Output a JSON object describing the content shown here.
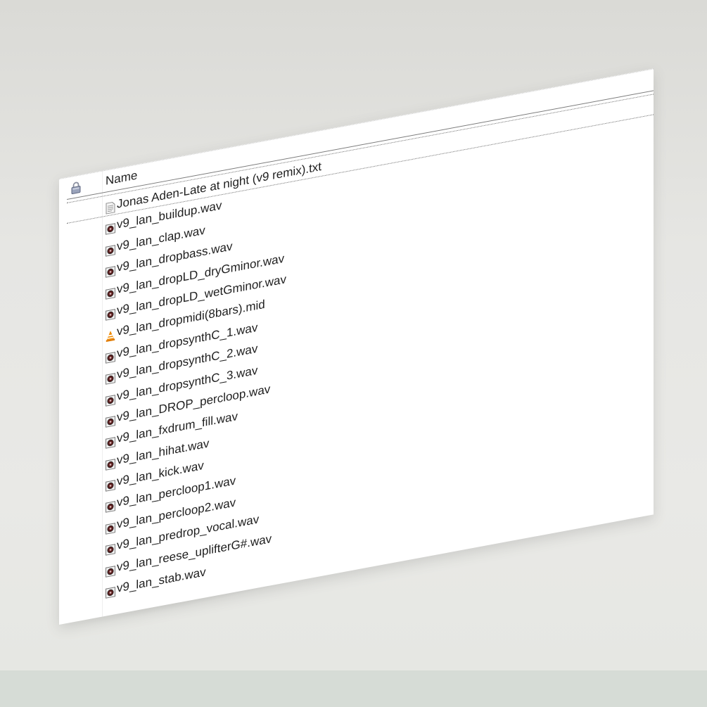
{
  "list": {
    "column_header": "Name"
  },
  "files": [
    {
      "name": "Jonas Aden-Late at night (v9 remix).txt",
      "icon": "text-file-icon"
    },
    {
      "name": "v9_lan_buildup.wav",
      "icon": "wav-file-icon"
    },
    {
      "name": "v9_lan_clap.wav",
      "icon": "wav-file-icon"
    },
    {
      "name": "v9_lan_dropbass.wav",
      "icon": "wav-file-icon"
    },
    {
      "name": "v9_lan_dropLD_dryGminor.wav",
      "icon": "wav-file-icon"
    },
    {
      "name": "v9_lan_dropLD_wetGminor.wav",
      "icon": "wav-file-icon"
    },
    {
      "name": "v9_lan_dropmidi(8bars).mid",
      "icon": "vlc-cone-icon"
    },
    {
      "name": "v9_lan_dropsynthC_1.wav",
      "icon": "wav-file-icon"
    },
    {
      "name": "v9_lan_dropsynthC_2.wav",
      "icon": "wav-file-icon"
    },
    {
      "name": "v9_lan_dropsynthC_3.wav",
      "icon": "wav-file-icon"
    },
    {
      "name": "v9_lan_DROP_percloop.wav",
      "icon": "wav-file-icon"
    },
    {
      "name": "v9_lan_fxdrum_fill.wav",
      "icon": "wav-file-icon"
    },
    {
      "name": "v9_lan_hihat.wav",
      "icon": "wav-file-icon"
    },
    {
      "name": "v9_lan_kick.wav",
      "icon": "wav-file-icon"
    },
    {
      "name": "v9_lan_percloop1.wav",
      "icon": "wav-file-icon"
    },
    {
      "name": "v9_lan_percloop2.wav",
      "icon": "wav-file-icon"
    },
    {
      "name": "v9_lan_predrop_vocal.wav",
      "icon": "wav-file-icon"
    },
    {
      "name": "v9_lan_reese_uplifterG#.wav",
      "icon": "wav-file-icon"
    },
    {
      "name": "v9_lan_stab.wav",
      "icon": "wav-file-icon"
    }
  ],
  "colors": {
    "text": "#1e1e1e",
    "panel": "#ffffff",
    "background": "#e6e6e3",
    "vlc_orange": "#f08a00"
  }
}
